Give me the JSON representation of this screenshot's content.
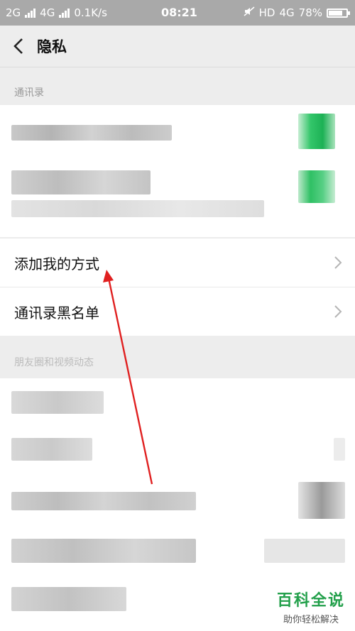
{
  "statusbar": {
    "net1": "2G",
    "net2": "4G",
    "speed": "0.1K/s",
    "time": "08:21",
    "hd": "HD",
    "net3": "4G",
    "battery": "78%",
    "battery_level": 0.78
  },
  "navbar": {
    "title": "隐私"
  },
  "sections": {
    "contacts_label": "通讯录",
    "moments_label": "朋友圈和视频动态"
  },
  "settings": {
    "add_me_label": "添加我的方式",
    "blacklist_label": "通讯录黑名单"
  },
  "watermark": {
    "title": "百科全说",
    "subtitle": "助你轻松解决"
  },
  "colors": {
    "accent_green": "#23a04b",
    "arrow_red": "#e02020"
  }
}
